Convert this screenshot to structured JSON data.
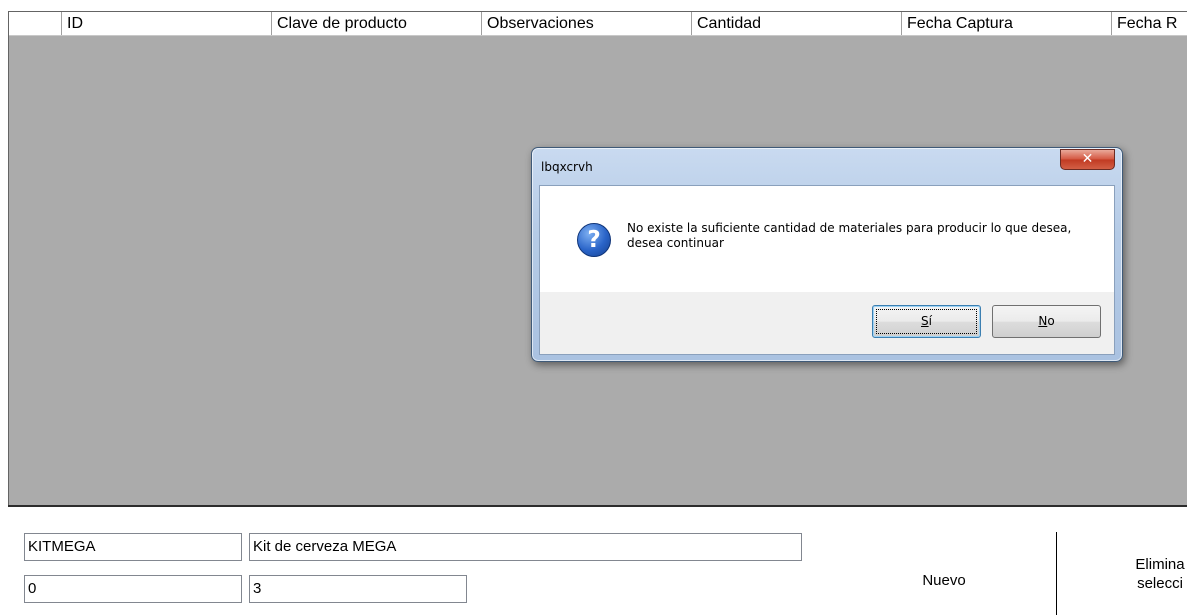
{
  "grid": {
    "columns": [
      "",
      "ID",
      "Clave de producto",
      "Observaciones",
      "Cantidad",
      "Fecha Captura",
      "Fecha R"
    ]
  },
  "dialog": {
    "title": "lbqxcrvh",
    "close_label": "✕",
    "icon": "question-icon",
    "icon_glyph": "?",
    "message": "No existe la suficiente cantidad de materiales para producir lo que desea, desea continuar",
    "yes_accel": "S",
    "yes_rest": "í",
    "no_accel": "N",
    "no_rest": "o"
  },
  "form": {
    "clave_value": "KITMEGA",
    "descripcion_value": "Kit de cerveza MEGA",
    "field3_value": "0",
    "cantidad_value": "3",
    "nuevo_label": "Nuevo",
    "eliminar_line1": "Elimina",
    "eliminar_line2": "selecci"
  }
}
